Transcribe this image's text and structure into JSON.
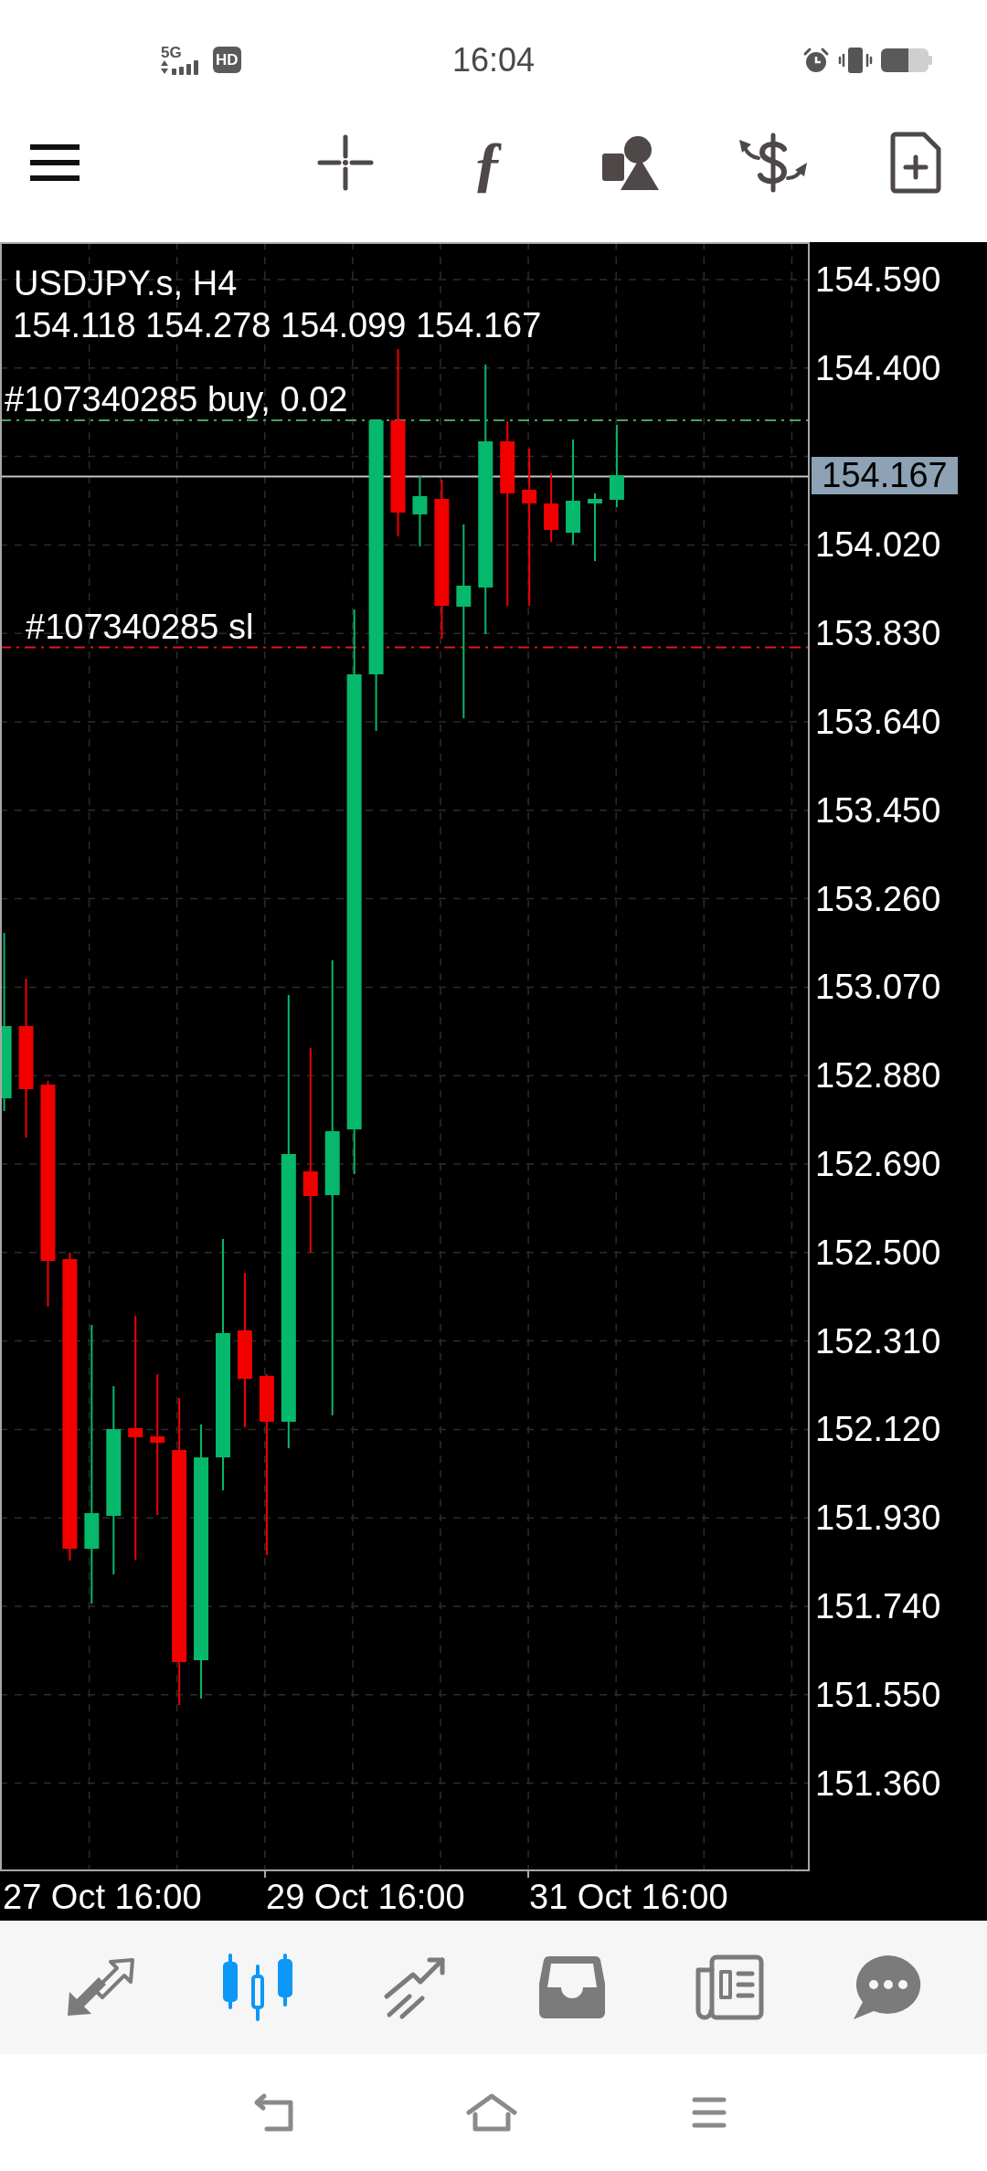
{
  "status_bar": {
    "network": "5G",
    "hd_badge": "HD",
    "time": "16:04"
  },
  "toolbar": {
    "function_glyph": "ƒ"
  },
  "chart": {
    "symbol": "USDJPY.s, H4",
    "ohlc": "154.118 154.278 154.099 154.167",
    "orders": [
      {
        "kind": "position",
        "label": "#107340285 buy, 0.02"
      },
      {
        "kind": "stop_loss",
        "label": "#107340285 sl"
      }
    ],
    "price_axis": [
      "154.590",
      "154.400",
      "154.020",
      "153.830",
      "153.640",
      "153.450",
      "153.260",
      "153.070",
      "152.880",
      "152.690",
      "152.500",
      "152.310",
      "152.120",
      "151.930",
      "151.740",
      "151.550",
      "151.360"
    ],
    "current_price": "154.167",
    "time_axis": [
      "27 Oct 16:00",
      "29 Oct 16:00",
      "31 Oct 16:00"
    ]
  },
  "bottom_nav": [
    {
      "kind": "quotes",
      "selected": false
    },
    {
      "kind": "chart",
      "selected": true
    },
    {
      "kind": "trade",
      "selected": false
    },
    {
      "kind": "history",
      "selected": false
    },
    {
      "kind": "news",
      "selected": false
    },
    {
      "kind": "messages",
      "selected": false
    }
  ]
}
